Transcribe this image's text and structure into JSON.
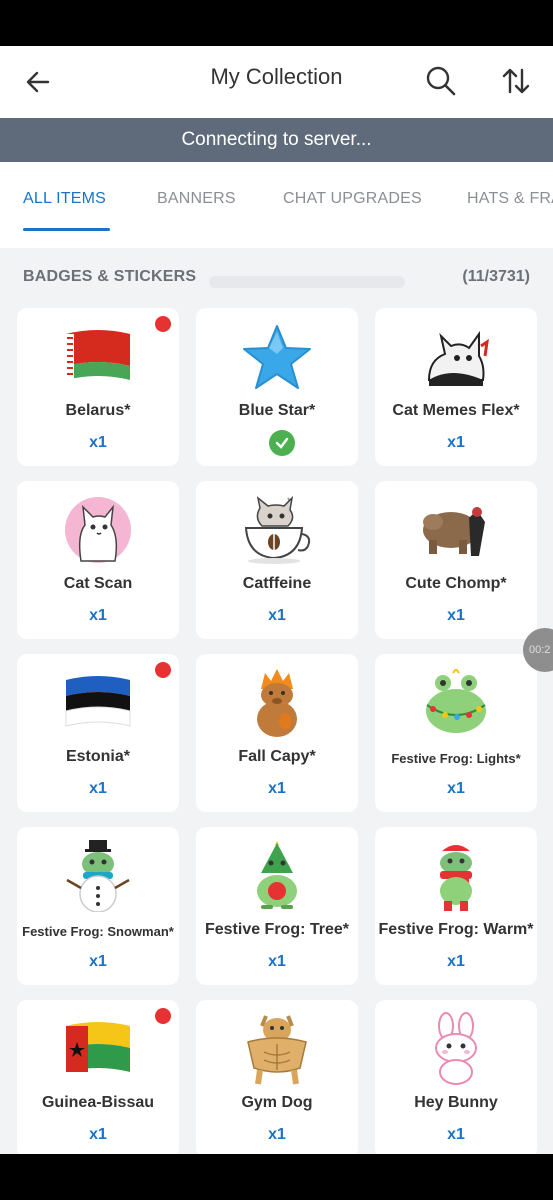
{
  "header": {
    "title": "My Collection"
  },
  "status_banner": "Connecting to server...",
  "tabs": [
    {
      "label": "ALL ITEMS"
    },
    {
      "label": "BANNERS"
    },
    {
      "label": "CHAT UPGRADES"
    },
    {
      "label": "HATS & FRA"
    }
  ],
  "section": {
    "label": "BADGES & STICKERS",
    "count": "(11/3731)"
  },
  "items": [
    {
      "name": "Belarus*",
      "qty": "x1",
      "icon": "belarus-flag-icon",
      "new": true
    },
    {
      "name": "Blue Star*",
      "qty": "",
      "icon": "blue-star-icon",
      "equipped": true
    },
    {
      "name": "Cat Memes Flex*",
      "qty": "x1",
      "icon": "cat-memes-flex-icon"
    },
    {
      "name": "Cat Scan",
      "qty": "x1",
      "icon": "cat-scan-icon"
    },
    {
      "name": "Catffeine",
      "qty": "x1",
      "icon": "catffeine-cup-icon"
    },
    {
      "name": "Cute Chomp*",
      "qty": "x1",
      "icon": "cute-chomp-icon"
    },
    {
      "name": "Estonia*",
      "qty": "x1",
      "icon": "estonia-flag-icon",
      "new": true
    },
    {
      "name": "Fall Capy*",
      "qty": "x1",
      "icon": "fall-capy-icon"
    },
    {
      "name": "Festive Frog: Lights*",
      "qty": "x1",
      "icon": "frog-lights-icon"
    },
    {
      "name": "Festive Frog: Snowman*",
      "qty": "x1",
      "icon": "frog-snowman-icon"
    },
    {
      "name": "Festive Frog: Tree*",
      "qty": "x1",
      "icon": "frog-tree-icon"
    },
    {
      "name": "Festive Frog: Warm*",
      "qty": "x1",
      "icon": "frog-warm-icon"
    },
    {
      "name": "Guinea-Bissau",
      "qty": "x1",
      "icon": "guinea-bissau-flag-icon",
      "new": true
    },
    {
      "name": "Gym Dog",
      "qty": "x1",
      "icon": "gym-dog-icon"
    },
    {
      "name": "Hey Bunny",
      "qty": "x1",
      "icon": "hey-bunny-icon"
    }
  ],
  "overlay": {
    "timer_text": "00:2"
  },
  "colors": {
    "accent": "#1a73c8",
    "banner": "#5f6b7a",
    "new_dot": "#e63232",
    "equipped": "#4caf50"
  }
}
